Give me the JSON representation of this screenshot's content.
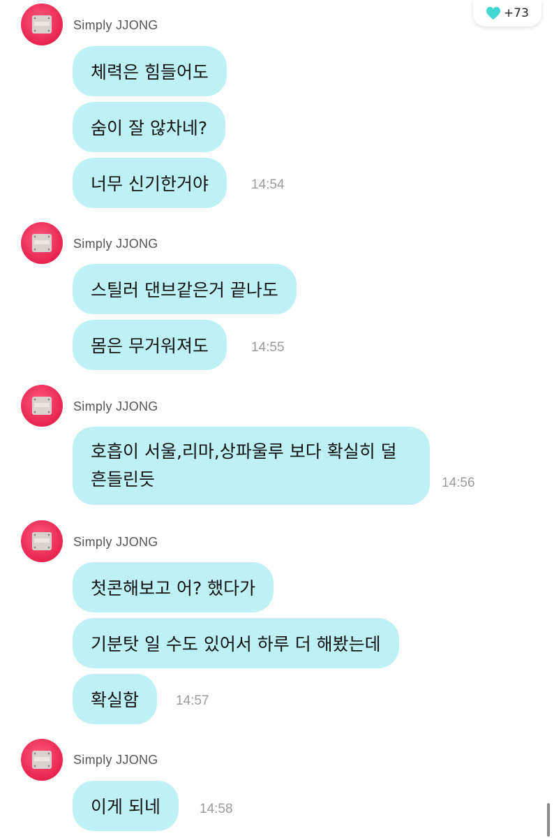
{
  "like_badge": {
    "count": "+73",
    "icon": "heart-icon",
    "color": "#3fd7d2"
  },
  "bubble_color": "#bdf1f5",
  "groups": [
    {
      "sender": "Simply JJONG",
      "messages": [
        "체력은 힘들어도",
        "숨이 잘 않차네?",
        "너무 신기한거야"
      ],
      "time": "14:54"
    },
    {
      "sender": "Simply JJONG",
      "messages": [
        "스틸러 댄브같은거 끝나도",
        "몸은 무거워져도"
      ],
      "time": "14:55"
    },
    {
      "sender": "Simply JJONG",
      "messages": [
        "호흡이 서울,리마,상파울루 보다 확실히 덜 흔들린듯"
      ],
      "time": "14:56"
    },
    {
      "sender": "Simply JJONG",
      "messages": [
        "첫콘해보고 어? 했다가",
        "기분탓 일 수도 있어서 하루 더 해봤는데",
        "확실함"
      ],
      "time": "14:57"
    },
    {
      "sender": "Simply JJONG",
      "messages": [
        "이게 되네"
      ],
      "time": "14:58"
    }
  ]
}
